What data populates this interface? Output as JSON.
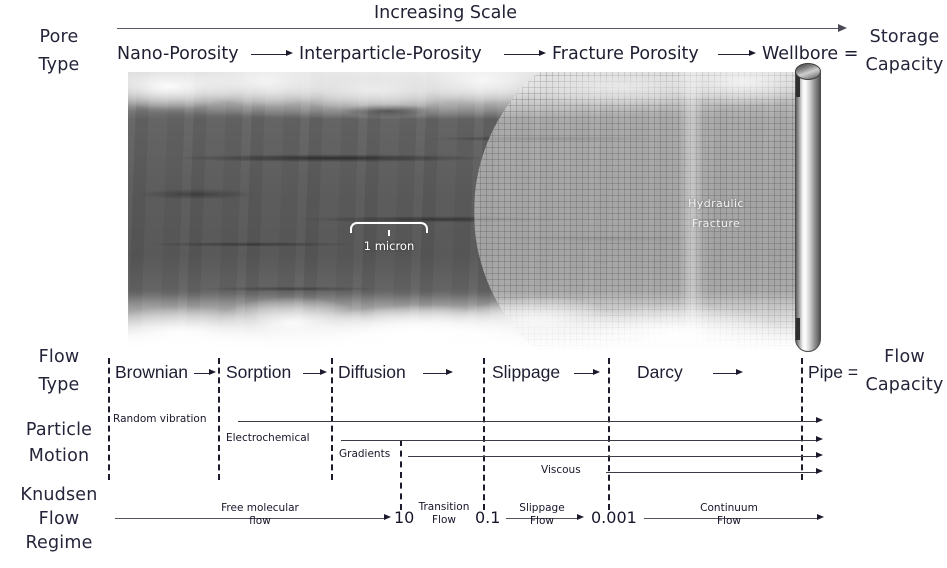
{
  "figure": {
    "top_axis_label": "Increasing Scale"
  },
  "row_captions": {
    "pore_type": [
      "Pore",
      "Type"
    ],
    "flow_type": [
      "Flow",
      "Type"
    ],
    "particle_motion": [
      "Particle",
      "Motion"
    ],
    "knudsen": [
      "Knudsen",
      "Flow",
      "Regime"
    ]
  },
  "right_captions": {
    "storage": [
      "Storage",
      "Capacity"
    ],
    "flow": [
      "Flow",
      "Capacity"
    ],
    "equals_top": "=",
    "equals_bottom": "="
  },
  "pore_types": [
    "Nano-Porosity",
    "Interparticle-Porosity",
    "Fracture Porosity",
    "Wellbore ="
  ],
  "sem_image": {
    "scale_bar_label": "1 micron",
    "fracture_label_line1": "Hydraulic",
    "fracture_label_line2": "Fracture"
  },
  "flow_types": [
    "Brownian",
    "Sorption",
    "Diffusion",
    "Slippage",
    "Darcy",
    "Pipe ="
  ],
  "particle_motion": [
    "Random vibration",
    "Electrochemical",
    "Gradients",
    "Viscous"
  ],
  "knudsen_flow_regime": {
    "boundaries": [
      "10",
      "0.1",
      "0.001"
    ],
    "regimes": [
      {
        "line1": "Free molecular",
        "line2": "flow"
      },
      {
        "line1": "Transition",
        "line2": "Flow"
      },
      {
        "line1": "Slippage",
        "line2": "Flow"
      },
      {
        "line1": "Continuum",
        "line2": "Flow"
      }
    ]
  },
  "colors": {
    "ink": "#1d1d2b",
    "rule": "#5a5a66",
    "dash": "#1b1b2c",
    "background": "#ffffff"
  }
}
